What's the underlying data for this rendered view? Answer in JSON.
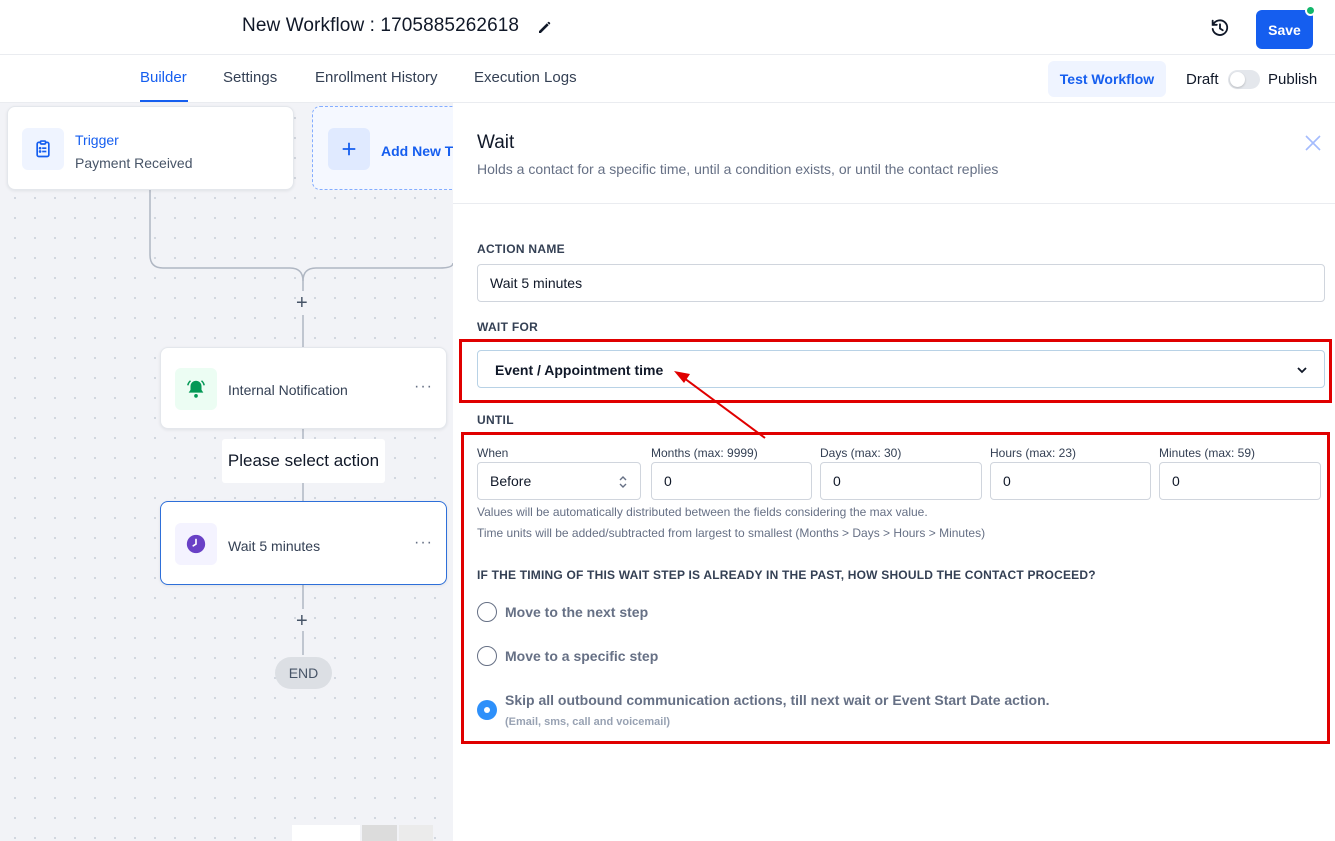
{
  "header": {
    "workflow_title": "New Workflow : 1705885262618",
    "save_label": "Save"
  },
  "tabs": [
    {
      "label": "Builder",
      "active": true
    },
    {
      "label": "Settings"
    },
    {
      "label": "Enrollment History"
    },
    {
      "label": "Execution Logs"
    }
  ],
  "toolbar": {
    "test_workflow_label": "Test Workflow",
    "draft_label": "Draft",
    "publish_label": "Publish",
    "published": false
  },
  "canvas": {
    "trigger": {
      "title": "Trigger",
      "subtitle": "Payment Received"
    },
    "add_trigger_label": "Add New T",
    "nodes": [
      {
        "label": "Internal Notification",
        "icon": "bell-icon",
        "color": "#12b76a"
      },
      {
        "label": "Wait 5 minutes",
        "icon": "clock-icon",
        "color": "#6941c6"
      }
    ],
    "tooltip": "Please select action",
    "end_label": "END",
    "menu_glyph": "···",
    "plus_glyph": "+"
  },
  "panel": {
    "title": "Wait",
    "subtitle": "Holds a contact for a specific time, until a condition exists, or until the contact replies",
    "action_name_label": "ACTION NAME",
    "action_name_value": "Wait 5 minutes",
    "wait_for_label": "WAIT FOR",
    "wait_for_value": "Event / Appointment time",
    "until_label": "UNTIL",
    "until": {
      "when_label": "When",
      "when_value": "Before",
      "months_label": "Months (max: 9999)",
      "months_value": "0",
      "days_label": "Days (max: 30)",
      "days_value": "0",
      "hours_label": "Hours (max: 23)",
      "hours_value": "0",
      "minutes_label": "Minutes (max: 59)",
      "minutes_value": "0"
    },
    "hint_1": "Values will be automatically distributed between the fields considering the max value.",
    "hint_2": "Time units will be added/subtracted from largest to smallest (Months > Days > Hours > Minutes)",
    "question": "IF THE TIMING OF THIS WAIT STEP IS ALREADY IN THE PAST, HOW SHOULD THE CONTACT PROCEED?",
    "options": [
      {
        "label": "Move to the next step",
        "checked": false
      },
      {
        "label": "Move to a specific step",
        "checked": false
      },
      {
        "label": "Skip all outbound communication actions, till next wait or Event Start Date action.",
        "sub": "(Email, sms, call and voicemail)",
        "checked": true
      }
    ]
  },
  "colors": {
    "primary": "#155eef",
    "annotation": "#e00000",
    "radio_checked": "#2e90fa"
  }
}
